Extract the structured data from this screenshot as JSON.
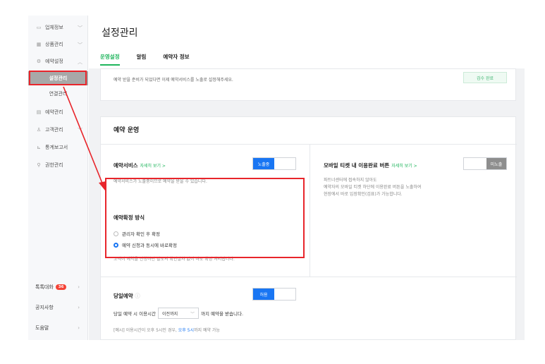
{
  "sidebar": {
    "items": [
      {
        "label": "업체정보",
        "icon": "store-icon"
      },
      {
        "label": "상품관리",
        "icon": "grid-icon"
      },
      {
        "label": "예약설정",
        "icon": "gear-icon"
      },
      {
        "label": "예약관리",
        "icon": "calendar-icon"
      },
      {
        "label": "고객관리",
        "icon": "person-icon"
      },
      {
        "label": "통계보고서",
        "icon": "chart-icon"
      },
      {
        "label": "권한관리",
        "icon": "search-icon"
      }
    ],
    "sub_items": [
      {
        "label": "설정관리"
      },
      {
        "label": "연결관리"
      }
    ],
    "bottom": [
      {
        "label": "톡톡대화",
        "badge": "36"
      },
      {
        "label": "공지사항"
      },
      {
        "label": "도움말"
      }
    ]
  },
  "header": {
    "title": "설정관리",
    "tabs": [
      {
        "label": "운영설정"
      },
      {
        "label": "알림"
      },
      {
        "label": "예약자 정보"
      }
    ]
  },
  "top_card": {
    "text": "예약 받을 준비가 되었다면 이제 예약서비스를 노출로 설정해주세요.",
    "button": "검수 완료"
  },
  "operation": {
    "title": "예약 운영",
    "service": {
      "label": "예약서비스",
      "link": "자세히 보기 >",
      "toggle": "노출중",
      "desc": "예약서비스가 노출중이므로 예약을 받을 수 있습니다."
    },
    "mobile_ticket": {
      "label": "모바일 티켓 내 이용완료 버튼",
      "link": "자세히 보기 >",
      "toggle": "미노출",
      "desc1": "파트너센터에 접속하지 않아도",
      "desc2": "예약자의 모바일 티켓 하단에 이용완료 버튼을 노출하여",
      "desc3": "현장에서 바로 입장확인(검표)가 가능합니다."
    },
    "confirm": {
      "label": "예약확정 방식",
      "option1": "관리자 확인 후 확정",
      "option2": "예약 신청과 동시에 바로확정",
      "desc": "고객이 예약을 신청하면 별도의 확인절차 없이 바로 확정 처리됩니다."
    },
    "same_day": {
      "label": "당일예약",
      "toggle": "허용",
      "prefix": "당일 예약 시 이용시간",
      "select": "이전까지",
      "suffix": "까지 예약을 받습니다.",
      "example_a": "[예시] 이용시간이 오후 5시인 경우,",
      "example_b": "오후 5시",
      "example_c": "까지 예약 가능"
    }
  }
}
